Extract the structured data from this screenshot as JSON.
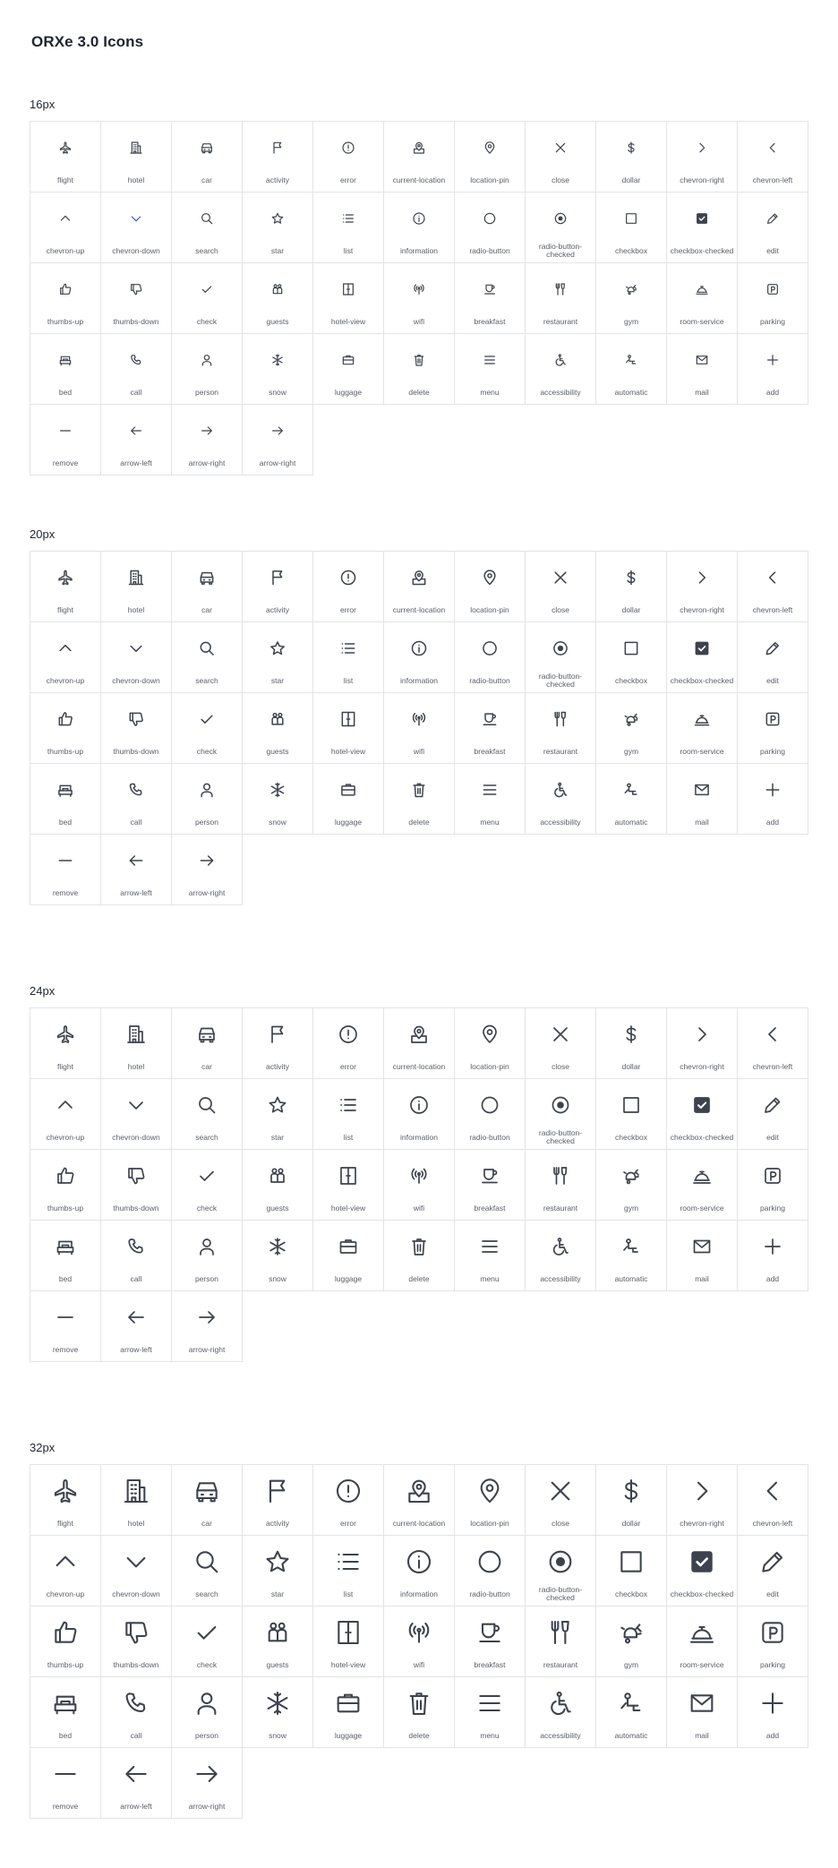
{
  "title": "ORXe 3.0 Icons",
  "colors": {
    "icon": "#3d424e",
    "label": "#5a5f6b",
    "border": "#e2e4e8",
    "accent": "#2e62c9",
    "fill": "#3d424e"
  },
  "sections": [
    {
      "label": "16px",
      "icon_size": 16,
      "icons": [
        {
          "name": "flight",
          "label": "flight"
        },
        {
          "name": "hotel",
          "label": "hotel"
        },
        {
          "name": "car",
          "label": "car"
        },
        {
          "name": "activity",
          "label": "activity"
        },
        {
          "name": "error",
          "label": "error"
        },
        {
          "name": "current-location",
          "label": "current-location"
        },
        {
          "name": "location-pin",
          "label": "location-pin"
        },
        {
          "name": "close",
          "label": "close"
        },
        {
          "name": "dollar",
          "label": "dollar"
        },
        {
          "name": "chevron-right",
          "label": "chevron-right"
        },
        {
          "name": "chevron-left",
          "label": "chevron-left"
        },
        {
          "name": "chevron-up",
          "label": "chevron-up"
        },
        {
          "name": "chevron-down",
          "label": "chevron-down",
          "accent": true
        },
        {
          "name": "search",
          "label": "search"
        },
        {
          "name": "star",
          "label": "star"
        },
        {
          "name": "list",
          "label": "list"
        },
        {
          "name": "information",
          "label": "information"
        },
        {
          "name": "radio-button",
          "label": "radio-button"
        },
        {
          "name": "radio-button-checked",
          "label": "radio-button-checked"
        },
        {
          "name": "checkbox",
          "label": "checkbox"
        },
        {
          "name": "checkbox-checked",
          "label": "checkbox-checked"
        },
        {
          "name": "edit",
          "label": "edit"
        },
        {
          "name": "thumbs-up",
          "label": "thumbs-up"
        },
        {
          "name": "thumbs-down",
          "label": "thumbs-down"
        },
        {
          "name": "check",
          "label": "check"
        },
        {
          "name": "guests",
          "label": "guests"
        },
        {
          "name": "hotel-view",
          "label": "hotel-view"
        },
        {
          "name": "wifi",
          "label": "wifi"
        },
        {
          "name": "breakfast",
          "label": "breakfast"
        },
        {
          "name": "restaurant",
          "label": "restaurant"
        },
        {
          "name": "gym",
          "label": "gym"
        },
        {
          "name": "room-service",
          "label": "room-service"
        },
        {
          "name": "parking",
          "label": "parking"
        },
        {
          "name": "bed",
          "label": "bed"
        },
        {
          "name": "call",
          "label": "call"
        },
        {
          "name": "person",
          "label": "person"
        },
        {
          "name": "snow",
          "label": "snow"
        },
        {
          "name": "luggage",
          "label": "luggage"
        },
        {
          "name": "delete",
          "label": "delete"
        },
        {
          "name": "menu",
          "label": "menu"
        },
        {
          "name": "accessibility",
          "label": "accessibility"
        },
        {
          "name": "automatic",
          "label": "automatic"
        },
        {
          "name": "mail",
          "label": "mail"
        },
        {
          "name": "add",
          "label": "add"
        },
        {
          "name": "remove",
          "label": "remove"
        },
        {
          "name": "arrow-left",
          "label": "arrow-left"
        },
        {
          "name": "arrow-right",
          "label": "arrow-right"
        },
        {
          "name": "arrow-right",
          "label": "arrow-right"
        }
      ]
    },
    {
      "label": "20px",
      "icon_size": 20,
      "icons": [
        {
          "name": "flight",
          "label": "flight"
        },
        {
          "name": "hotel",
          "label": "hotel"
        },
        {
          "name": "car",
          "label": "car"
        },
        {
          "name": "activity",
          "label": "activity"
        },
        {
          "name": "error",
          "label": "error"
        },
        {
          "name": "current-location",
          "label": "current-location"
        },
        {
          "name": "location-pin",
          "label": "location-pin"
        },
        {
          "name": "close",
          "label": "close"
        },
        {
          "name": "dollar",
          "label": "dollar"
        },
        {
          "name": "chevron-right",
          "label": "chevron-right"
        },
        {
          "name": "chevron-left",
          "label": "chevron-left"
        },
        {
          "name": "chevron-up",
          "label": "chevron-up"
        },
        {
          "name": "chevron-down",
          "label": "chevron-down"
        },
        {
          "name": "search",
          "label": "search"
        },
        {
          "name": "star",
          "label": "star"
        },
        {
          "name": "list",
          "label": "list"
        },
        {
          "name": "information",
          "label": "information"
        },
        {
          "name": "radio-button",
          "label": "radio-button"
        },
        {
          "name": "radio-button-checked",
          "label": "radio-button-checked"
        },
        {
          "name": "checkbox",
          "label": "checkbox"
        },
        {
          "name": "checkbox-checked",
          "label": "checkbox-checked"
        },
        {
          "name": "edit",
          "label": "edit"
        },
        {
          "name": "thumbs-up",
          "label": "thumbs-up"
        },
        {
          "name": "thumbs-down",
          "label": "thumbs-down"
        },
        {
          "name": "check",
          "label": "check"
        },
        {
          "name": "guests",
          "label": "guests"
        },
        {
          "name": "hotel-view",
          "label": "hotel-view"
        },
        {
          "name": "wifi",
          "label": "wifi"
        },
        {
          "name": "breakfast",
          "label": "breakfast"
        },
        {
          "name": "restaurant",
          "label": "restaurant"
        },
        {
          "name": "gym",
          "label": "gym"
        },
        {
          "name": "room-service",
          "label": "room-service"
        },
        {
          "name": "parking",
          "label": "parking"
        },
        {
          "name": "bed",
          "label": "bed"
        },
        {
          "name": "call",
          "label": "call"
        },
        {
          "name": "person",
          "label": "person"
        },
        {
          "name": "snow",
          "label": "snow"
        },
        {
          "name": "luggage",
          "label": "luggage"
        },
        {
          "name": "delete",
          "label": "delete"
        },
        {
          "name": "menu",
          "label": "menu"
        },
        {
          "name": "accessibility",
          "label": "accessibility"
        },
        {
          "name": "automatic",
          "label": "automatic"
        },
        {
          "name": "mail",
          "label": "mail"
        },
        {
          "name": "add",
          "label": "add"
        },
        {
          "name": "remove",
          "label": "remove"
        },
        {
          "name": "arrow-left",
          "label": "arrow-left"
        },
        {
          "name": "arrow-right",
          "label": "arrow-right"
        }
      ]
    },
    {
      "label": "24px",
      "icon_size": 24,
      "icons": [
        {
          "name": "flight",
          "label": "flight"
        },
        {
          "name": "hotel",
          "label": "hotel"
        },
        {
          "name": "car",
          "label": "car"
        },
        {
          "name": "activity",
          "label": "activity"
        },
        {
          "name": "error",
          "label": "error"
        },
        {
          "name": "current-location",
          "label": "current-location"
        },
        {
          "name": "location-pin",
          "label": "location-pin"
        },
        {
          "name": "close",
          "label": "close"
        },
        {
          "name": "dollar",
          "label": "dollar"
        },
        {
          "name": "chevron-right",
          "label": "chevron-right"
        },
        {
          "name": "chevron-left",
          "label": "chevron-left"
        },
        {
          "name": "chevron-up",
          "label": "chevron-up"
        },
        {
          "name": "chevron-down",
          "label": "chevron-down"
        },
        {
          "name": "search",
          "label": "search"
        },
        {
          "name": "star",
          "label": "star"
        },
        {
          "name": "list",
          "label": "list"
        },
        {
          "name": "information",
          "label": "information"
        },
        {
          "name": "radio-button",
          "label": "radio-button"
        },
        {
          "name": "radio-button-checked",
          "label": "radio-button-checked"
        },
        {
          "name": "checkbox",
          "label": "checkbox"
        },
        {
          "name": "checkbox-checked",
          "label": "checkbox-checked"
        },
        {
          "name": "edit",
          "label": "edit"
        },
        {
          "name": "thumbs-up",
          "label": "thumbs-up"
        },
        {
          "name": "thumbs-down",
          "label": "thumbs-down"
        },
        {
          "name": "check",
          "label": "check"
        },
        {
          "name": "guests",
          "label": "guests"
        },
        {
          "name": "hotel-view",
          "label": "hotel-view"
        },
        {
          "name": "wifi",
          "label": "wifi"
        },
        {
          "name": "breakfast",
          "label": "breakfast"
        },
        {
          "name": "restaurant",
          "label": "restaurant"
        },
        {
          "name": "gym",
          "label": "gym"
        },
        {
          "name": "room-service",
          "label": "room-service"
        },
        {
          "name": "parking",
          "label": "parking"
        },
        {
          "name": "bed",
          "label": "bed"
        },
        {
          "name": "call",
          "label": "call"
        },
        {
          "name": "person",
          "label": "person"
        },
        {
          "name": "snow",
          "label": "snow"
        },
        {
          "name": "luggage",
          "label": "luggage"
        },
        {
          "name": "delete",
          "label": "delete"
        },
        {
          "name": "menu",
          "label": "menu"
        },
        {
          "name": "accessibility",
          "label": "accessibility"
        },
        {
          "name": "automatic",
          "label": "automatic"
        },
        {
          "name": "mail",
          "label": "mail"
        },
        {
          "name": "add",
          "label": "add"
        },
        {
          "name": "remove",
          "label": "remove"
        },
        {
          "name": "arrow-left",
          "label": "arrow-left"
        },
        {
          "name": "arrow-right",
          "label": "arrow-right"
        }
      ]
    },
    {
      "label": "32px",
      "icon_size": 32,
      "icons": [
        {
          "name": "flight",
          "label": "flight"
        },
        {
          "name": "hotel",
          "label": "hotel"
        },
        {
          "name": "car",
          "label": "car"
        },
        {
          "name": "activity",
          "label": "activity"
        },
        {
          "name": "error",
          "label": "error"
        },
        {
          "name": "current-location",
          "label": "current-location"
        },
        {
          "name": "location-pin",
          "label": "location-pin"
        },
        {
          "name": "close",
          "label": "close"
        },
        {
          "name": "dollar",
          "label": "dollar"
        },
        {
          "name": "chevron-right",
          "label": "chevron-right"
        },
        {
          "name": "chevron-left",
          "label": "chevron-left"
        },
        {
          "name": "chevron-up",
          "label": "chevron-up"
        },
        {
          "name": "chevron-down",
          "label": "chevron-down"
        },
        {
          "name": "search",
          "label": "search"
        },
        {
          "name": "star",
          "label": "star"
        },
        {
          "name": "list",
          "label": "list"
        },
        {
          "name": "information",
          "label": "information"
        },
        {
          "name": "radio-button",
          "label": "radio-button"
        },
        {
          "name": "radio-button-checked",
          "label": "radio-button-checked"
        },
        {
          "name": "checkbox",
          "label": "checkbox"
        },
        {
          "name": "checkbox-checked",
          "label": "checkbox-checked"
        },
        {
          "name": "edit",
          "label": "edit"
        },
        {
          "name": "thumbs-up",
          "label": "thumbs-up"
        },
        {
          "name": "thumbs-down",
          "label": "thumbs-down"
        },
        {
          "name": "check",
          "label": "check"
        },
        {
          "name": "guests",
          "label": "guests"
        },
        {
          "name": "hotel-view",
          "label": "hotel-view"
        },
        {
          "name": "wifi",
          "label": "wifi"
        },
        {
          "name": "breakfast",
          "label": "breakfast"
        },
        {
          "name": "restaurant",
          "label": "restaurant"
        },
        {
          "name": "gym",
          "label": "gym"
        },
        {
          "name": "room-service",
          "label": "room-service"
        },
        {
          "name": "parking",
          "label": "parking"
        },
        {
          "name": "bed",
          "label": "bed"
        },
        {
          "name": "call",
          "label": "call"
        },
        {
          "name": "person",
          "label": "person"
        },
        {
          "name": "snow",
          "label": "snow"
        },
        {
          "name": "luggage",
          "label": "luggage"
        },
        {
          "name": "delete",
          "label": "delete"
        },
        {
          "name": "menu",
          "label": "menu"
        },
        {
          "name": "accessibility",
          "label": "accessibility"
        },
        {
          "name": "automatic",
          "label": "automatic"
        },
        {
          "name": "mail",
          "label": "mail"
        },
        {
          "name": "add",
          "label": "add"
        },
        {
          "name": "remove",
          "label": "remove"
        },
        {
          "name": "arrow-left",
          "label": "arrow-left"
        },
        {
          "name": "arrow-right",
          "label": "arrow-right"
        }
      ]
    }
  ]
}
